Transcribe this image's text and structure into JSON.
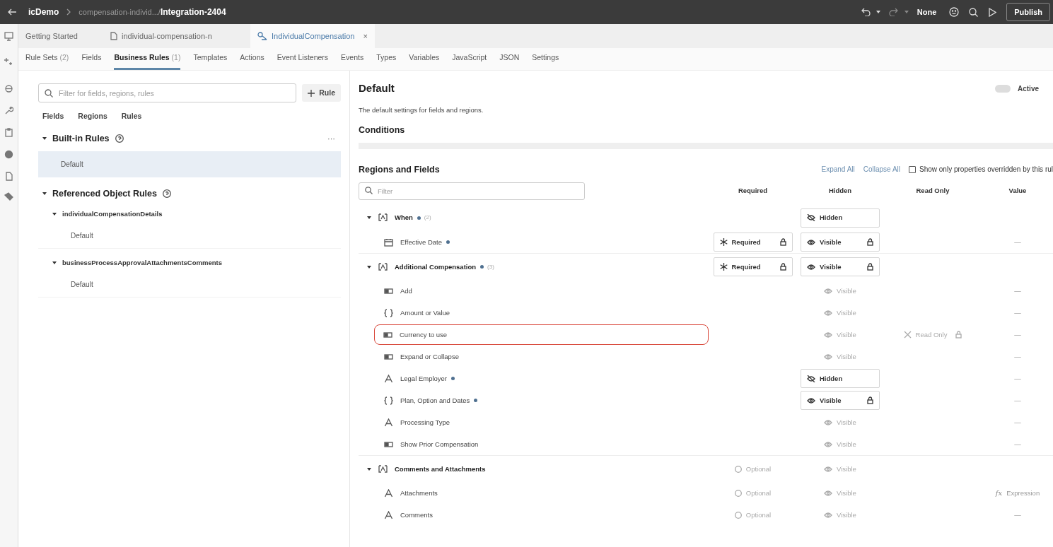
{
  "topbar": {
    "app": "icDemo",
    "path": "compensation-individ.../",
    "title": "Integration-2404",
    "mode": "None",
    "publish": "Publish"
  },
  "tabs": [
    {
      "label": "Getting Started",
      "selected": false
    },
    {
      "label": "individual-compensation-n",
      "selected": false
    },
    {
      "label": "IndividualCompensation",
      "selected": true,
      "close": "×"
    }
  ],
  "subtabs": [
    {
      "label": "Rule Sets",
      "count": "(2)",
      "selected": false
    },
    {
      "label": "Fields",
      "selected": false
    },
    {
      "label": "Business Rules",
      "count": "(1)",
      "selected": true
    },
    {
      "label": "Templates",
      "selected": false
    },
    {
      "label": "Actions",
      "selected": false
    },
    {
      "label": "Event Listeners",
      "selected": false
    },
    {
      "label": "Events",
      "selected": false
    },
    {
      "label": "Types",
      "selected": false
    },
    {
      "label": "Variables",
      "selected": false
    },
    {
      "label": "JavaScript",
      "selected": false
    },
    {
      "label": "JSON",
      "selected": false
    },
    {
      "label": "Settings",
      "selected": false
    }
  ],
  "left": {
    "search": {
      "placeholder": "Filter for fields, regions, rules"
    },
    "add_button": "Rule",
    "filters": [
      "Fields",
      "Regions",
      "Rules"
    ],
    "sections": [
      {
        "title": "Built-in Rules",
        "expanded": true,
        "menu": "···",
        "items": [
          {
            "label": "Default",
            "selected": true
          }
        ]
      },
      {
        "title": "Referenced Object Rules",
        "expanded": true,
        "groups": [
          {
            "title": "individualCompensationDetails",
            "expanded": true,
            "items": [
              {
                "label": "Default",
                "selected": false
              }
            ]
          },
          {
            "title": "businessProcessApprovalAttachmentsComments",
            "expanded": true,
            "items": [
              {
                "label": "Default",
                "selected": false
              }
            ]
          }
        ]
      }
    ]
  },
  "rule": {
    "title": "Default",
    "active": {
      "label": "Active",
      "on": false
    },
    "description": "The default settings for fields and regions.",
    "conditions_title": "Conditions"
  },
  "regions": {
    "title": "Regions and Fields",
    "expand_all": "Expand All",
    "collapse_all": "Collapse All",
    "override_filter": {
      "label": "Show only properties overridden by this rul",
      "checked": false
    },
    "filter": {
      "placeholder": "Filter"
    },
    "columns": [
      "Required",
      "Hidden",
      "Read Only",
      "Value"
    ],
    "rows": [
      {
        "label": "When",
        "kind": "region",
        "expanded": true,
        "modified": true,
        "count": "(2)",
        "hidden": {
          "kind": "hidden",
          "label": "Hidden",
          "emphasized": true,
          "locked": false
        }
      },
      {
        "label": "Effective Date",
        "kind": "date",
        "modified": true,
        "required": {
          "kind": "required",
          "label": "Required",
          "emphasized": true,
          "locked": true
        },
        "hidden": {
          "kind": "visible",
          "label": "Visible",
          "emphasized": true,
          "locked": true
        },
        "value": "—"
      },
      {
        "label": "Additional Compensation",
        "kind": "region",
        "expanded": true,
        "modified": true,
        "count": "(3)",
        "required": {
          "kind": "required",
          "label": "Required",
          "emphasized": true,
          "locked": true
        },
        "hidden": {
          "kind": "visible",
          "label": "Visible",
          "emphasized": true,
          "locked": true
        }
      },
      {
        "label": "Add",
        "kind": "toggle",
        "modified": false,
        "hidden": {
          "kind": "visible",
          "label": "Visible",
          "emphasized": false,
          "locked": false
        },
        "value": "—"
      },
      {
        "label": "Amount or Value",
        "kind": "group",
        "modified": false,
        "hidden": {
          "kind": "visible",
          "label": "Visible",
          "emphasized": false,
          "locked": false
        },
        "value": "—"
      },
      {
        "label": "Currency to use",
        "kind": "toggle",
        "modified": false,
        "highlighted": true,
        "hidden": {
          "kind": "visible",
          "label": "Visible",
          "emphasized": false,
          "locked": false
        },
        "read_only": {
          "kind": "readonly",
          "label": "Read Only",
          "emphasized": false,
          "locked": true
        },
        "value": "—"
      },
      {
        "label": "Expand or Collapse",
        "kind": "toggle",
        "modified": false,
        "hidden": {
          "kind": "visible",
          "label": "Visible",
          "emphasized": false,
          "locked": false
        },
        "value": "—"
      },
      {
        "label": "Legal Employer",
        "kind": "text",
        "modified": true,
        "hidden": {
          "kind": "hidden",
          "label": "Hidden",
          "emphasized": true,
          "locked": false
        },
        "value": "—"
      },
      {
        "label": "Plan, Option and Dates",
        "kind": "group",
        "modified": true,
        "hidden": {
          "kind": "visible",
          "label": "Visible",
          "emphasized": true,
          "locked": true
        },
        "value": "—"
      },
      {
        "label": "Processing Type",
        "kind": "text",
        "modified": false,
        "hidden": {
          "kind": "visible",
          "label": "Visible",
          "emphasized": false,
          "locked": false
        },
        "value": "—"
      },
      {
        "label": "Show Prior Compensation",
        "kind": "toggle",
        "modified": false,
        "hidden": {
          "kind": "visible",
          "label": "Visible",
          "emphasized": false,
          "locked": false
        },
        "value": "—"
      },
      {
        "label": "Comments and Attachments",
        "kind": "region",
        "expanded": true,
        "modified": false,
        "required": {
          "kind": "optional",
          "label": "Optional",
          "emphasized": false,
          "locked": false
        },
        "hidden": {
          "kind": "visible",
          "label": "Visible",
          "emphasized": false,
          "locked": false
        }
      },
      {
        "label": "Attachments",
        "kind": "text",
        "modified": false,
        "required": {
          "kind": "optional",
          "label": "Optional",
          "emphasized": false,
          "locked": false
        },
        "hidden": {
          "kind": "visible",
          "label": "Visible",
          "emphasized": false,
          "locked": false
        },
        "value_icon": "fx",
        "value": "Expression"
      },
      {
        "label": "Comments",
        "kind": "text",
        "modified": false,
        "required": {
          "kind": "optional",
          "label": "Optional",
          "emphasized": false,
          "locked": false
        },
        "hidden": {
          "kind": "visible",
          "label": "Visible",
          "emphasized": false,
          "locked": false
        },
        "value": "—"
      }
    ]
  }
}
